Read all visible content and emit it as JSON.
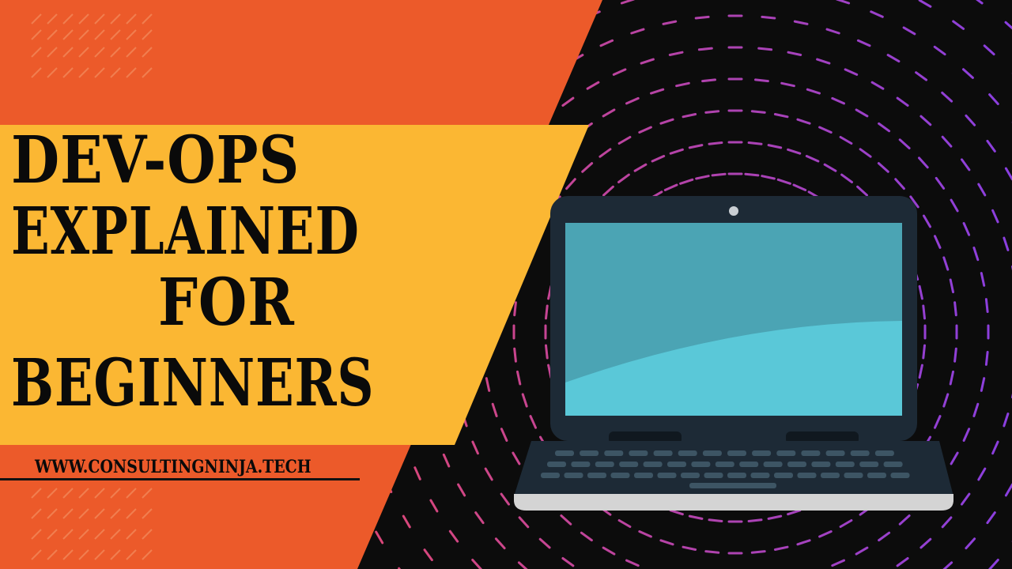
{
  "title": {
    "line1": "DEV-OPS",
    "line2": "EXPLAINED",
    "line3": "FOR",
    "line4": "BEGINNERS"
  },
  "website": "WWW.CONSULTINGNINJA.TECH",
  "colors": {
    "orange": "#EC5A2A",
    "yellow": "#FBB733",
    "dark_background": "#0C0C0C",
    "title_text": "#0A0A0A",
    "dash_pink": "#D9477A",
    "dash_purple": "#8A3FE0",
    "laptop_frame": "#1D2A36",
    "screen_light": "#5AC8D8",
    "screen_dark": "#4BA4B4",
    "laptop_base": "#D4D4D4"
  },
  "icons": [
    "laptop-icon",
    "webcam-icon"
  ]
}
